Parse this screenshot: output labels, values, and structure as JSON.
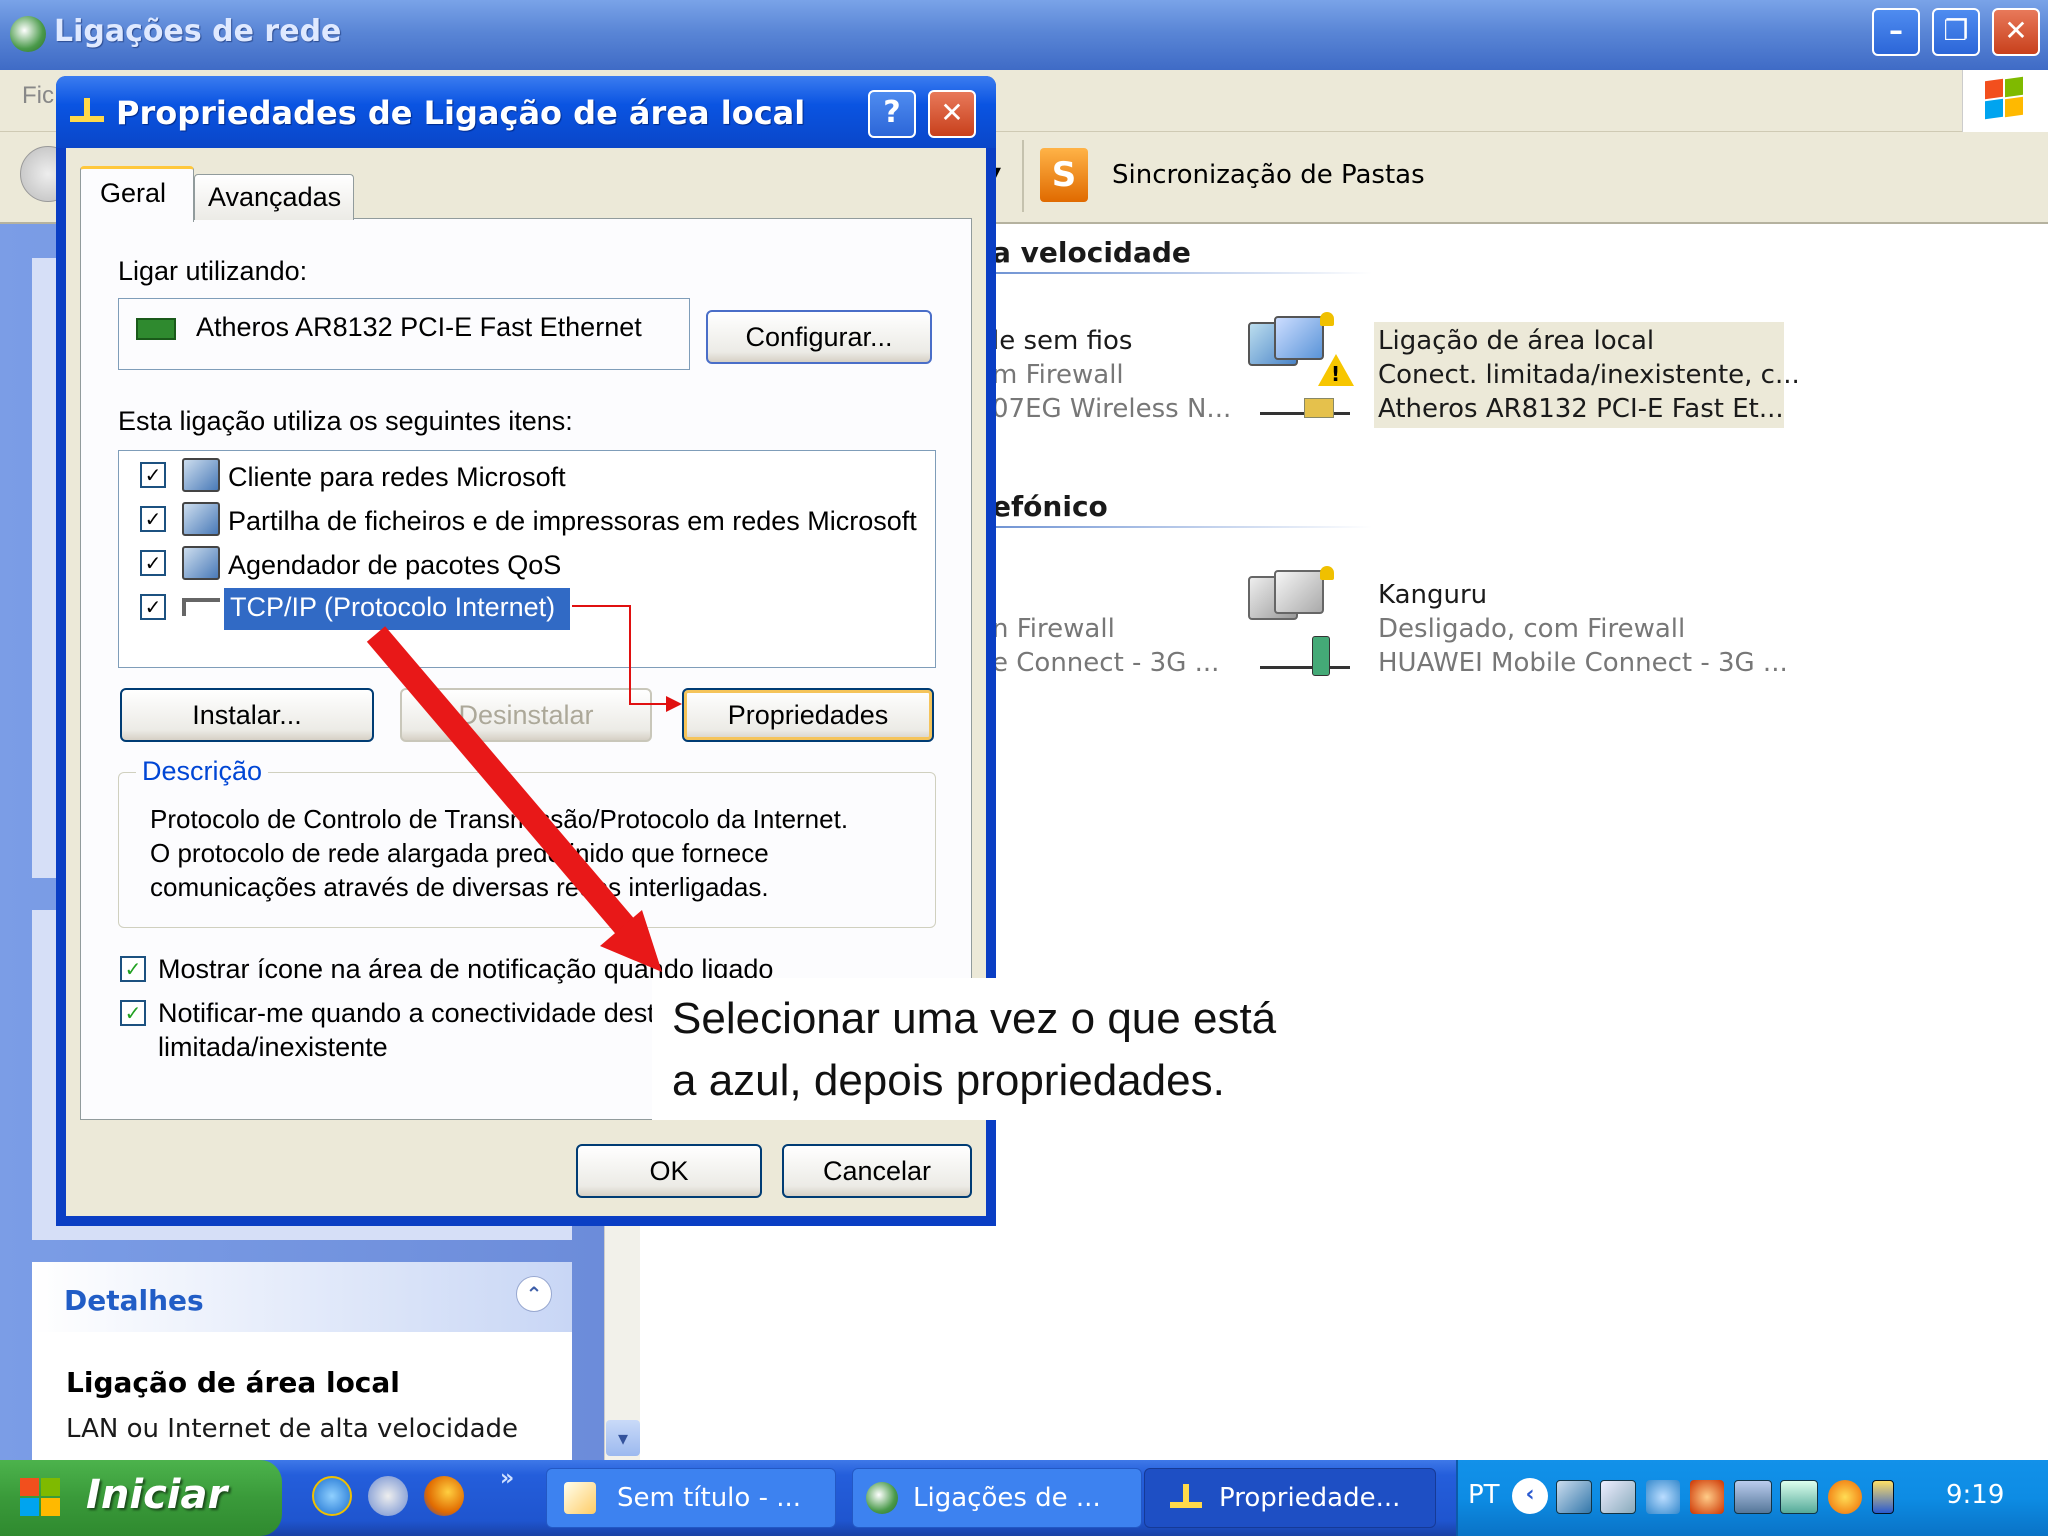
{
  "main_window": {
    "title": "Ligações de rede",
    "menu_first": "Fic",
    "toolbar_sync": "Sincronização de Pastas"
  },
  "content": {
    "group_broadband": "a velocidade",
    "group_dialup": "efónico",
    "wireless": {
      "line1": "le sem fios",
      "line2": "m Firewall",
      "line3": "07EG Wireless N..."
    },
    "lan": {
      "name": "Ligação de área local",
      "status": "Conect. limitada/inexistente, c...",
      "device": "Atheros AR8132 PCI-E Fast Et..."
    },
    "partial3g": {
      "line1": "n Firewall",
      "line2": "e Connect - 3G ..."
    },
    "kanguru": {
      "name": "Kanguru",
      "status": "Desligado, com Firewall",
      "device": "HUAWEI Mobile Connect - 3G ..."
    }
  },
  "details": {
    "title": "Detalhes",
    "name": "Ligação de área local",
    "type": "LAN ou Internet de alta velocidade"
  },
  "dialog": {
    "title": "Propriedades de Ligação de área local",
    "help": "?",
    "close": "✕",
    "tabs": [
      "Geral",
      "Avançadas"
    ],
    "connect_using_label": "Ligar utilizando:",
    "adapter": "Atheros AR8132 PCI-E Fast Ethernet",
    "configure_button": "Configurar...",
    "items_label": "Esta ligação utiliza os seguintes itens:",
    "items": [
      {
        "label": "Cliente para redes Microsoft",
        "checked": true
      },
      {
        "label": "Partilha de ficheiros e de impressoras em redes Microsoft",
        "checked": true
      },
      {
        "label": "Agendador de pacotes QoS",
        "checked": true
      },
      {
        "label": "TCP/IP (Protocolo Internet)",
        "checked": true
      }
    ],
    "install_button": "Instalar...",
    "uninstall_button": "Desinstalar",
    "properties_button": "Propriedades",
    "description_title": "Descrição",
    "description_lines": [
      "Protocolo de Controlo de Transmissão/Protocolo da Internet.",
      "O protocolo de rede alargada predefinido que fornece",
      "comunicações através de diversas redes interligadas."
    ],
    "show_icon_label": "Mostrar ícone na área de notificação quando ligado",
    "notify_label_1": "Notificar-me quando a conectividade desta ligação for",
    "notify_label_2": "limitada/inexistente",
    "ok_button": "OK",
    "cancel_button": "Cancelar"
  },
  "annotation": {
    "line1": "Selecionar uma vez o que está",
    "line2": "a azul, depois propriedades."
  },
  "taskbar": {
    "start": "Iniciar",
    "chevron": "»",
    "tasks": [
      "Sem título - ...",
      "Ligações de ...",
      "Propriedade..."
    ],
    "language": "PT",
    "clock": "9:19"
  }
}
